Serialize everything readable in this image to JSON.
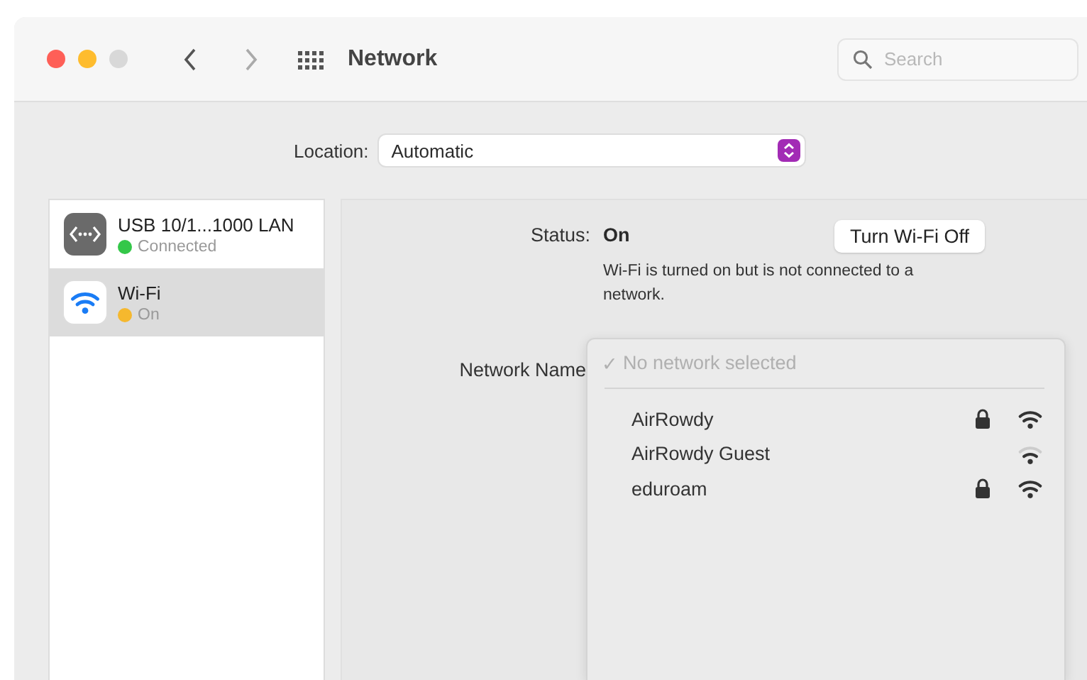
{
  "window": {
    "title": "Network",
    "search_placeholder": "Search"
  },
  "location": {
    "label": "Location:",
    "value": "Automatic"
  },
  "services": [
    {
      "kind": "ethernet",
      "name": "USB 10/1...1000 LAN",
      "status": "Connected",
      "color": "#34c749",
      "selected": false
    },
    {
      "kind": "wifi",
      "name": "Wi-Fi",
      "status": "On",
      "color": "#f5b82e",
      "selected": true
    }
  ],
  "detail": {
    "status_label": "Status:",
    "status_value": "On",
    "toggle_button": "Turn Wi-Fi Off",
    "description": "Wi-Fi is turned on but is not connected to a network.",
    "network_name_label": "Network Name"
  },
  "network_menu": {
    "current": {
      "check": "✓",
      "label": "No network selected"
    },
    "networks": [
      {
        "name": "AirRowdy",
        "locked": true,
        "weak_signal": false
      },
      {
        "name": "AirRowdy Guest",
        "locked": false,
        "weak_signal": true
      },
      {
        "name": "eduroam",
        "locked": true,
        "weak_signal": false
      }
    ]
  }
}
